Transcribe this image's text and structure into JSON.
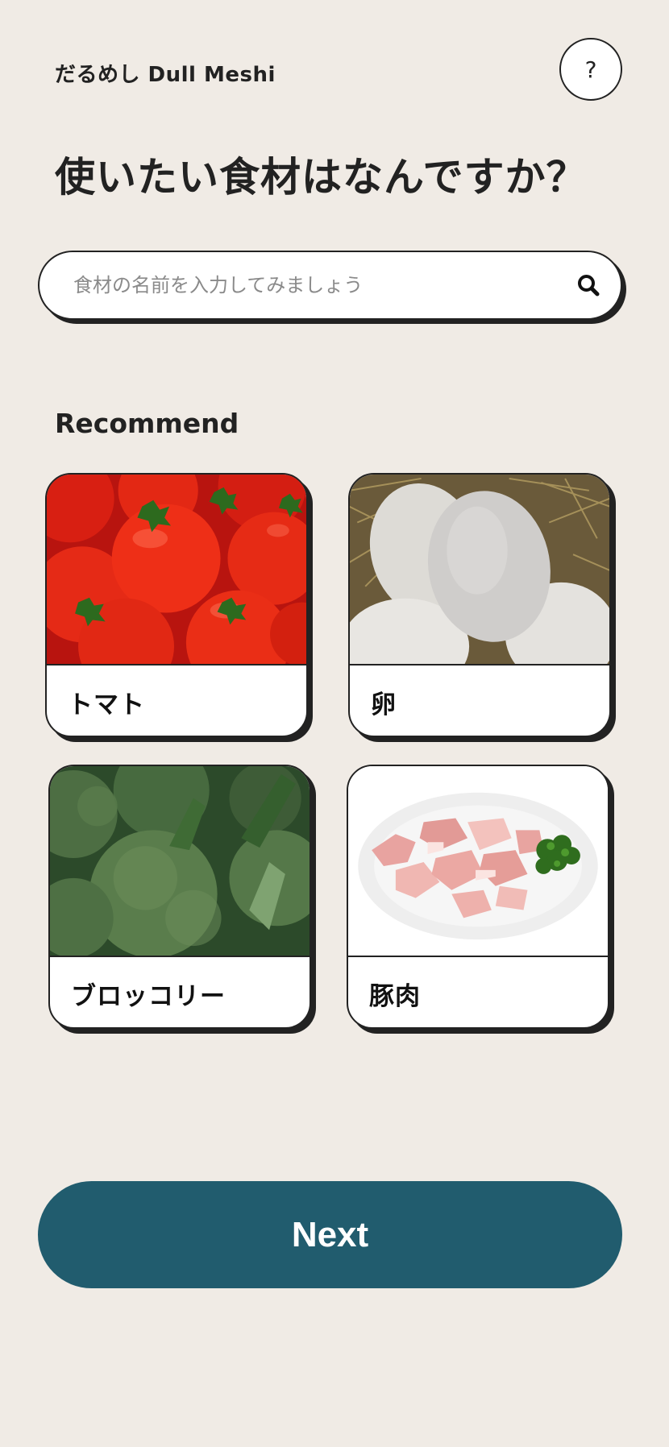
{
  "header": {
    "app_name": "だるめし Dull Meshi",
    "help_label": "?"
  },
  "title": "使いたい食材はなんですか？",
  "search": {
    "placeholder": "食材の名前を入力してみましょう",
    "value": "",
    "icon": "search-icon"
  },
  "recommend": {
    "label": "Recommend",
    "items": [
      {
        "label": "トマト",
        "image": "tomato-photo"
      },
      {
        "label": "卵",
        "image": "egg-photo"
      },
      {
        "label": "ブロッコリー",
        "image": "broccoli-photo"
      },
      {
        "label": "豚肉",
        "image": "pork-photo"
      }
    ]
  },
  "next_button": {
    "label": "Next"
  },
  "colors": {
    "background": "#f0ebe5",
    "accent": "#215c6e",
    "border": "#222222"
  }
}
